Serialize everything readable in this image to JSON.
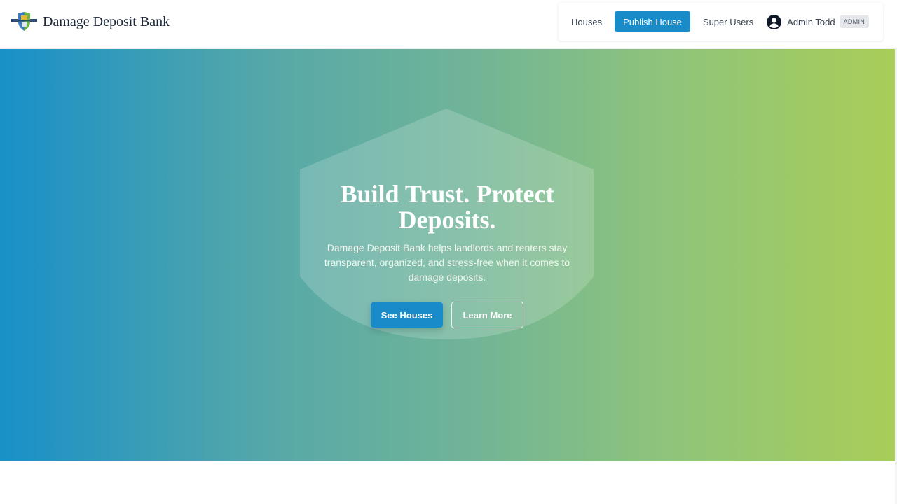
{
  "header": {
    "brand_name": "Damage Deposit Bank",
    "logo_icon": "shield-logo-icon"
  },
  "nav": {
    "houses": "Houses",
    "publish_house": "Publish House",
    "super_users": "Super Users",
    "user_name": "Admin Todd",
    "user_badge": "ADMIN",
    "user_icon": "user-circle-icon"
  },
  "hero": {
    "title": "Build Trust. Protect Deposits.",
    "text": "Damage Deposit Bank helps landlords and renters stay transparent, organized, and stress-free when it comes to damage deposits.",
    "primary_button": "See Houses",
    "secondary_button": "Learn More"
  },
  "colors": {
    "accent": "#1a8bc9",
    "gradient_start": "#1890c8",
    "gradient_end": "#a9cd58"
  }
}
